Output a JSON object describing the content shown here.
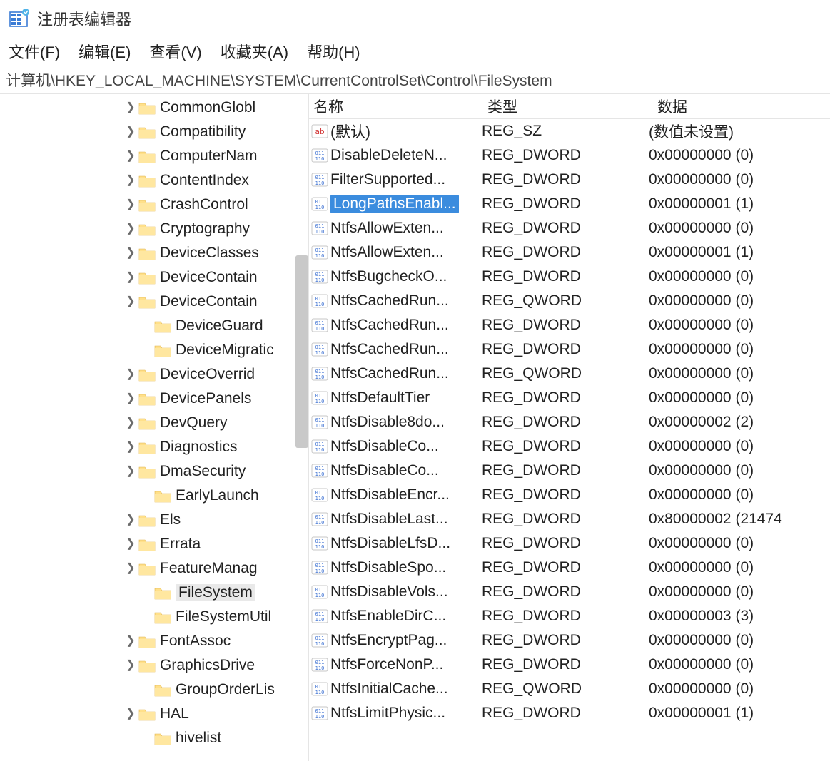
{
  "window": {
    "title": "注册表编辑器"
  },
  "menu": {
    "items": [
      "文件(F)",
      "编辑(E)",
      "查看(V)",
      "收藏夹(A)",
      "帮助(H)"
    ]
  },
  "address": "计算机\\HKEY_LOCAL_MACHINE\\SYSTEM\\CurrentControlSet\\Control\\FileSystem",
  "tree": {
    "items": [
      {
        "label": "CommonGlobl",
        "expandable": true,
        "selected": false,
        "indent": 172
      },
      {
        "label": "Compatibility",
        "expandable": true,
        "selected": false,
        "indent": 172
      },
      {
        "label": "ComputerNam",
        "expandable": true,
        "selected": false,
        "indent": 172
      },
      {
        "label": "ContentIndex",
        "expandable": true,
        "selected": false,
        "indent": 172
      },
      {
        "label": "CrashControl",
        "expandable": true,
        "selected": false,
        "indent": 172
      },
      {
        "label": "Cryptography",
        "expandable": true,
        "selected": false,
        "indent": 172
      },
      {
        "label": "DeviceClasses",
        "expandable": true,
        "selected": false,
        "indent": 172
      },
      {
        "label": "DeviceContain",
        "expandable": true,
        "selected": false,
        "indent": 172
      },
      {
        "label": "DeviceContain",
        "expandable": true,
        "selected": false,
        "indent": 172
      },
      {
        "label": "DeviceGuard",
        "expandable": false,
        "selected": false,
        "indent": 194
      },
      {
        "label": "DeviceMigratic",
        "expandable": false,
        "selected": false,
        "indent": 194
      },
      {
        "label": "DeviceOverrid",
        "expandable": true,
        "selected": false,
        "indent": 172
      },
      {
        "label": "DevicePanels",
        "expandable": true,
        "selected": false,
        "indent": 172
      },
      {
        "label": "DevQuery",
        "expandable": true,
        "selected": false,
        "indent": 172
      },
      {
        "label": "Diagnostics",
        "expandable": true,
        "selected": false,
        "indent": 172
      },
      {
        "label": "DmaSecurity",
        "expandable": true,
        "selected": false,
        "indent": 172
      },
      {
        "label": "EarlyLaunch",
        "expandable": false,
        "selected": false,
        "indent": 194
      },
      {
        "label": "Els",
        "expandable": true,
        "selected": false,
        "indent": 172
      },
      {
        "label": "Errata",
        "expandable": true,
        "selected": false,
        "indent": 172
      },
      {
        "label": "FeatureManag",
        "expandable": true,
        "selected": false,
        "indent": 172
      },
      {
        "label": "FileSystem",
        "expandable": false,
        "selected": true,
        "indent": 194
      },
      {
        "label": "FileSystemUtil",
        "expandable": false,
        "selected": false,
        "indent": 194
      },
      {
        "label": "FontAssoc",
        "expandable": true,
        "selected": false,
        "indent": 172
      },
      {
        "label": "GraphicsDrive",
        "expandable": true,
        "selected": false,
        "indent": 172
      },
      {
        "label": "GroupOrderLis",
        "expandable": false,
        "selected": false,
        "indent": 194
      },
      {
        "label": "HAL",
        "expandable": true,
        "selected": false,
        "indent": 172
      },
      {
        "label": "hivelist",
        "expandable": false,
        "selected": false,
        "indent": 194
      }
    ]
  },
  "values": {
    "columns": {
      "name": "名称",
      "type": "类型",
      "data": "数据"
    },
    "rows": [
      {
        "icon": "sz",
        "name": "(默认)",
        "type": "REG_SZ",
        "data": "(数值未设置)",
        "selected": false
      },
      {
        "icon": "bin",
        "name": "DisableDeleteN...",
        "type": "REG_DWORD",
        "data": "0x00000000 (0)",
        "selected": false
      },
      {
        "icon": "bin",
        "name": "FilterSupported...",
        "type": "REG_DWORD",
        "data": "0x00000000 (0)",
        "selected": false
      },
      {
        "icon": "bin",
        "name": "LongPathsEnabl...",
        "type": "REG_DWORD",
        "data": "0x00000001 (1)",
        "selected": true
      },
      {
        "icon": "bin",
        "name": "NtfsAllowExten...",
        "type": "REG_DWORD",
        "data": "0x00000000 (0)",
        "selected": false
      },
      {
        "icon": "bin",
        "name": "NtfsAllowExten...",
        "type": "REG_DWORD",
        "data": "0x00000001 (1)",
        "selected": false
      },
      {
        "icon": "bin",
        "name": "NtfsBugcheckO...",
        "type": "REG_DWORD",
        "data": "0x00000000 (0)",
        "selected": false
      },
      {
        "icon": "bin",
        "name": "NtfsCachedRun...",
        "type": "REG_QWORD",
        "data": "0x00000000 (0)",
        "selected": false
      },
      {
        "icon": "bin",
        "name": "NtfsCachedRun...",
        "type": "REG_DWORD",
        "data": "0x00000000 (0)",
        "selected": false
      },
      {
        "icon": "bin",
        "name": "NtfsCachedRun...",
        "type": "REG_DWORD",
        "data": "0x00000000 (0)",
        "selected": false
      },
      {
        "icon": "bin",
        "name": "NtfsCachedRun...",
        "type": "REG_QWORD",
        "data": "0x00000000 (0)",
        "selected": false
      },
      {
        "icon": "bin",
        "name": "NtfsDefaultTier",
        "type": "REG_DWORD",
        "data": "0x00000000 (0)",
        "selected": false
      },
      {
        "icon": "bin",
        "name": "NtfsDisable8do...",
        "type": "REG_DWORD",
        "data": "0x00000002 (2)",
        "selected": false
      },
      {
        "icon": "bin",
        "name": "NtfsDisableCo...",
        "type": "REG_DWORD",
        "data": "0x00000000 (0)",
        "selected": false
      },
      {
        "icon": "bin",
        "name": "NtfsDisableCo...",
        "type": "REG_DWORD",
        "data": "0x00000000 (0)",
        "selected": false
      },
      {
        "icon": "bin",
        "name": "NtfsDisableEncr...",
        "type": "REG_DWORD",
        "data": "0x00000000 (0)",
        "selected": false
      },
      {
        "icon": "bin",
        "name": "NtfsDisableLast...",
        "type": "REG_DWORD",
        "data": "0x80000002 (21474",
        "selected": false
      },
      {
        "icon": "bin",
        "name": "NtfsDisableLfsD...",
        "type": "REG_DWORD",
        "data": "0x00000000 (0)",
        "selected": false
      },
      {
        "icon": "bin",
        "name": "NtfsDisableSpo...",
        "type": "REG_DWORD",
        "data": "0x00000000 (0)",
        "selected": false
      },
      {
        "icon": "bin",
        "name": "NtfsDisableVols...",
        "type": "REG_DWORD",
        "data": "0x00000000 (0)",
        "selected": false
      },
      {
        "icon": "bin",
        "name": "NtfsEnableDirC...",
        "type": "REG_DWORD",
        "data": "0x00000003 (3)",
        "selected": false
      },
      {
        "icon": "bin",
        "name": "NtfsEncryptPag...",
        "type": "REG_DWORD",
        "data": "0x00000000 (0)",
        "selected": false
      },
      {
        "icon": "bin",
        "name": "NtfsForceNonP...",
        "type": "REG_DWORD",
        "data": "0x00000000 (0)",
        "selected": false
      },
      {
        "icon": "bin",
        "name": "NtfsInitialCache...",
        "type": "REG_QWORD",
        "data": "0x00000000 (0)",
        "selected": false
      },
      {
        "icon": "bin",
        "name": "NtfsLimitPhysic...",
        "type": "REG_DWORD",
        "data": "0x00000001 (1)",
        "selected": false
      }
    ]
  }
}
